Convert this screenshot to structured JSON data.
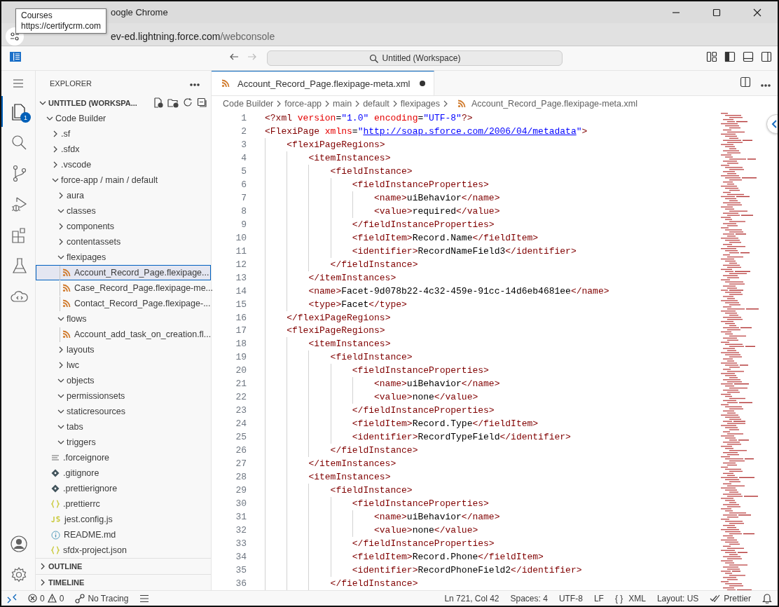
{
  "window": {
    "title": "oogle Chrome",
    "url_host": "ev-ed.lightning.force.com",
    "url_path": "/webconsole"
  },
  "tooltip": {
    "title": "Courses",
    "url": "https://certifycrm.com"
  },
  "command_center": {
    "text": "Untitled (Workspace)"
  },
  "activity_bar": [
    {
      "kind": "files",
      "selected": true,
      "badge": "1"
    },
    {
      "kind": "search",
      "selected": false
    },
    {
      "kind": "source-control",
      "selected": false
    },
    {
      "kind": "debug",
      "selected": false
    },
    {
      "kind": "extensions",
      "selected": false
    },
    {
      "kind": "testing",
      "selected": false
    },
    {
      "kind": "cloud",
      "selected": false
    }
  ],
  "sidebar": {
    "title": "EXPLORER",
    "workspace": "UNTITLED (WORKSPA...",
    "tree": [
      {
        "label": "Code Builder",
        "kind": "folder",
        "expanded": true,
        "selected": false,
        "children": [
          {
            "label": ".sf",
            "kind": "folder",
            "expanded": false,
            "selected": false
          },
          {
            "label": ".sfdx",
            "kind": "folder",
            "expanded": false,
            "selected": false
          },
          {
            "label": ".vscode",
            "kind": "folder",
            "expanded": false,
            "selected": false
          },
          {
            "label": "force-app / main / default",
            "kind": "folder",
            "expanded": true,
            "selected": false,
            "children": [
              {
                "label": "aura",
                "kind": "folder",
                "expanded": false,
                "selected": false
              },
              {
                "label": "classes",
                "kind": "folder",
                "expanded": true,
                "selected": false
              },
              {
                "label": "components",
                "kind": "folder",
                "expanded": false,
                "selected": false
              },
              {
                "label": "contentassets",
                "kind": "folder",
                "expanded": false,
                "selected": false
              },
              {
                "label": "flexipages",
                "kind": "folder",
                "expanded": true,
                "selected": false,
                "children": [
                  {
                    "label": "Account_Record_Page.flexipage...",
                    "kind": "xml-file",
                    "selected": true
                  },
                  {
                    "label": "Case_Record_Page.flexipage-me...",
                    "kind": "xml-file",
                    "selected": false
                  },
                  {
                    "label": "Contact_Record_Page.flexipage-...",
                    "kind": "xml-file",
                    "selected": false
                  }
                ]
              },
              {
                "label": "flows",
                "kind": "folder",
                "expanded": true,
                "selected": false,
                "children": [
                  {
                    "label": "Account_add_task_on_creation.fl...",
                    "kind": "xml-file",
                    "selected": false
                  }
                ]
              },
              {
                "label": "layouts",
                "kind": "folder",
                "expanded": false,
                "selected": false
              },
              {
                "label": "lwc",
                "kind": "folder",
                "expanded": false,
                "selected": false
              },
              {
                "label": "objects",
                "kind": "folder",
                "expanded": true,
                "selected": false
              },
              {
                "label": "permissionsets",
                "kind": "folder",
                "expanded": true,
                "selected": false
              },
              {
                "label": "staticresources",
                "kind": "folder",
                "expanded": true,
                "selected": false
              },
              {
                "label": "tabs",
                "kind": "folder",
                "expanded": true,
                "selected": false
              },
              {
                "label": "triggers",
                "kind": "folder",
                "expanded": true,
                "selected": false
              }
            ]
          },
          {
            "label": ".forceignore",
            "kind": "text-file",
            "selected": false
          },
          {
            "label": ".gitignore",
            "kind": "ignore-file",
            "selected": false
          },
          {
            "label": ".prettierignore",
            "kind": "ignore-file",
            "selected": false
          },
          {
            "label": ".prettierrc",
            "kind": "json-file",
            "selected": false
          },
          {
            "label": "jest.config.js",
            "kind": "js-file",
            "selected": false
          },
          {
            "label": "README.md",
            "kind": "info-file",
            "selected": false
          },
          {
            "label": "sfdx-project.json",
            "kind": "json-file",
            "selected": false
          }
        ]
      }
    ],
    "sections": [
      {
        "label": "OUTLINE",
        "expanded": false
      },
      {
        "label": "TIMELINE",
        "expanded": false
      }
    ]
  },
  "editor": {
    "tab": {
      "label": "Account_Record_Page.flexipage-meta.xml",
      "modified": true,
      "selected": true
    },
    "breadcrumb": [
      "Code Builder",
      "force-app",
      "main",
      "default",
      "flexipages",
      "Account_Record_Page.flexipage-meta.xml"
    ],
    "lines": [
      {
        "n": "1",
        "code": "<?xml version=\"1.0\" encoding=\"UTF-8\"?>"
      },
      {
        "n": "2",
        "code": "<FlexiPage xmlns=\"http://soap.sforce.com/2006/04/metadata\">",
        "link": true
      },
      {
        "n": "3",
        "code": "    <flexiPageRegions>"
      },
      {
        "n": "4",
        "code": "        <itemInstances>"
      },
      {
        "n": "5",
        "code": "            <fieldInstance>"
      },
      {
        "n": "6",
        "code": "                <fieldInstanceProperties>"
      },
      {
        "n": "7",
        "code": "                    <name>uiBehavior</name>"
      },
      {
        "n": "8",
        "code": "                    <value>required</value>"
      },
      {
        "n": "9",
        "code": "                </fieldInstanceProperties>"
      },
      {
        "n": "10",
        "code": "                <fieldItem>Record.Name</fieldItem>"
      },
      {
        "n": "11",
        "code": "                <identifier>RecordNameField3</identifier>"
      },
      {
        "n": "12",
        "code": "            </fieldInstance>"
      },
      {
        "n": "13",
        "code": "        </itemInstances>"
      },
      {
        "n": "14",
        "code": "        <name>Facet-9d078b22-4c32-459e-91cc-14d6eb4681ee</name>"
      },
      {
        "n": "15",
        "code": "        <type>Facet</type>"
      },
      {
        "n": "16",
        "code": "    </flexiPageRegions>"
      },
      {
        "n": "17",
        "code": "    <flexiPageRegions>"
      },
      {
        "n": "18",
        "code": "        <itemInstances>"
      },
      {
        "n": "19",
        "code": "            <fieldInstance>"
      },
      {
        "n": "20",
        "code": "                <fieldInstanceProperties>"
      },
      {
        "n": "21",
        "code": "                    <name>uiBehavior</name>"
      },
      {
        "n": "22",
        "code": "                    <value>none</value>"
      },
      {
        "n": "23",
        "code": "                </fieldInstanceProperties>"
      },
      {
        "n": "24",
        "code": "                <fieldItem>Record.Type</fieldItem>"
      },
      {
        "n": "25",
        "code": "                <identifier>RecordTypeField</identifier>"
      },
      {
        "n": "26",
        "code": "            </fieldInstance>"
      },
      {
        "n": "27",
        "code": "        </itemInstances>"
      },
      {
        "n": "28",
        "code": "        <itemInstances>"
      },
      {
        "n": "29",
        "code": "            <fieldInstance>"
      },
      {
        "n": "30",
        "code": "                <fieldInstanceProperties>"
      },
      {
        "n": "31",
        "code": "                    <name>uiBehavior</name>"
      },
      {
        "n": "32",
        "code": "                    <value>none</value>"
      },
      {
        "n": "33",
        "code": "                </fieldInstanceProperties>"
      },
      {
        "n": "34",
        "code": "                <fieldItem>Record.Phone</fieldItem>"
      },
      {
        "n": "35",
        "code": "                <identifier>RecordPhoneField2</identifier>"
      },
      {
        "n": "36",
        "code": "            </fieldInstance>"
      }
    ]
  },
  "status_bar": {
    "errors": "0",
    "warnings": "0",
    "tracing": "No Tracing",
    "right": [
      {
        "text": "Ln 721, Col 42"
      },
      {
        "text": "Spaces: 4"
      },
      {
        "text": "UTF-8"
      },
      {
        "text": "LF"
      },
      {
        "text": "{ }",
        "kind": "braces"
      },
      {
        "text": "XML"
      },
      {
        "text": "Layout: US"
      },
      {
        "text": "Prettier",
        "kind": "check"
      }
    ]
  }
}
